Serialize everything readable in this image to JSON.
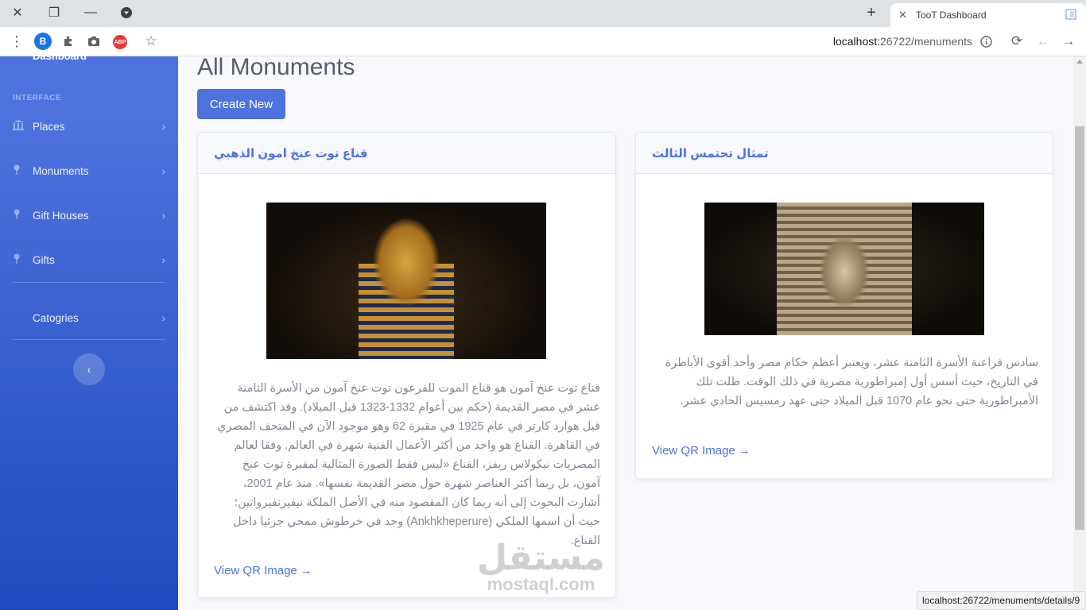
{
  "browser": {
    "tab_title": "TooT Dashboard",
    "tab_close": "✕",
    "new_tab": "+",
    "url_host": "localhost:",
    "url_path": "26722/menuments",
    "ext_b": "B",
    "ext_abp": "ABP"
  },
  "sidebar": {
    "dashboard": "Dashboard",
    "heading": "INTERFACE",
    "items": [
      {
        "label": "Places",
        "icon": "building-icon"
      },
      {
        "label": "Monuments",
        "icon": "map-pin-icon"
      },
      {
        "label": "Gift Houses",
        "icon": "map-pin-icon"
      },
      {
        "label": "Gifts",
        "icon": "map-pin-icon"
      },
      {
        "label": "Catogries",
        "icon": ""
      }
    ]
  },
  "main": {
    "title": "All Monuments",
    "create_button": "Create New",
    "cards": [
      {
        "title": "قناع توت عنخ امون الذهبي",
        "image": "golden-mask-photo",
        "description": "قناع توت عنخ آمون هو قناع الموت للفرعون توت عنخ آمون من الأسرة الثامنة عشر في مصر القديمة (حكم بين أعوام 1332-1323 قبل الميلاد). وقد اكتشف من قبل هوارد كارتر في عام 1925 في مقبرة 62 وهو موجود الآن في المتحف المصري في القاهرة. القناع هو واحد من أكثر الأعمال الفنية شهرة في العالم. وفقا لعالم المصريات نيكولاس ريفز، القناع «ليس فقط الصورة المثالية لمقبرة توت عنخ آمون، بل ربما أكثر العناصر شهرة حول مصر القديمة نفسها». منذ عام 2001، أشارت البحوث إلى أنه ربما كان المقصود منه في الأصل الملكة نيفيرنفيرواتين؛ حيث أن اسمها الملكي (Ankhkheperure) وجد في خرطوش ممحي جزئيا داخل القناع.",
        "link": "View QR Image →"
      },
      {
        "title": "تمثال تحتمس الثالث",
        "image": "thutmose-statue-photo",
        "description": "سادس فراعنة الأسرة الثامنة عشر، ويعتبر أعظم حكام مصر وأحد أقوى الأباطرة في التاريخ، حيث أسس أول إمبراطورية مصرية في ذلك الوقت. ظلت تلك الأمبراطورية حتى نحو عام 1070 قبل الميلاد حتى عهد رمسيس الحادي عشر.",
        "link": "View QR Image →"
      }
    ]
  },
  "status_bar": {
    "hover_url": "localhost:26722/menuments/details/9"
  },
  "watermark": {
    "arabic": "مستقل",
    "latin": "mostaql.com"
  },
  "colors": {
    "primary": "#4e73df",
    "sidebar_end": "#224abe",
    "text_muted": "#858796"
  }
}
